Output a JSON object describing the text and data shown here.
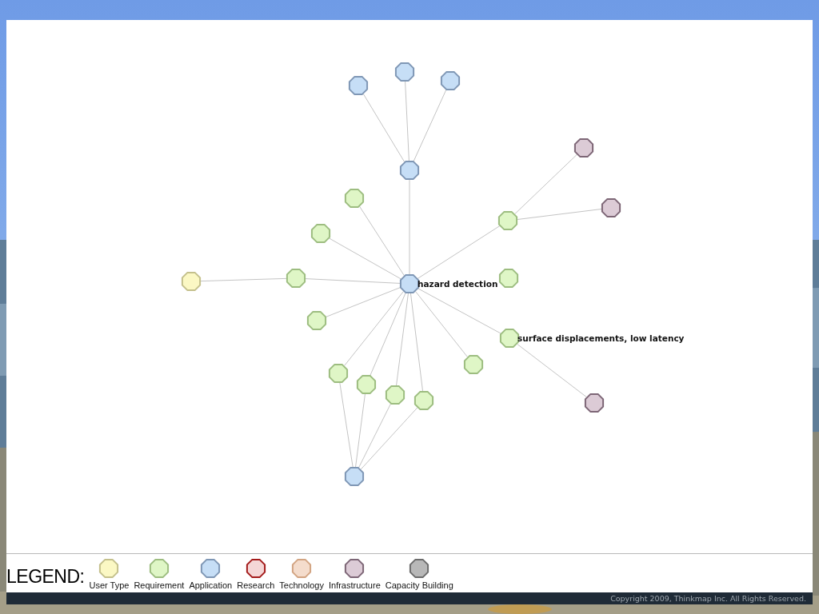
{
  "graph": {
    "nodes": [
      {
        "kind": "application",
        "label": "hazard detection"
      },
      {
        "kind": "application"
      },
      {
        "kind": "application"
      },
      {
        "kind": "application"
      },
      {
        "kind": "application"
      },
      {
        "kind": "requirement"
      },
      {
        "kind": "requirement"
      },
      {
        "kind": "requirement"
      },
      {
        "kind": "user_type"
      },
      {
        "kind": "requirement"
      },
      {
        "kind": "requirement"
      },
      {
        "kind": "infrastructure"
      },
      {
        "kind": "infrastructure"
      },
      {
        "kind": "requirement"
      },
      {
        "kind": "requirement",
        "label": "surface displacements, low latency"
      },
      {
        "kind": "infrastructure"
      },
      {
        "kind": "requirement"
      },
      {
        "kind": "requirement"
      },
      {
        "kind": "requirement"
      },
      {
        "kind": "requirement"
      },
      {
        "kind": "requirement"
      },
      {
        "kind": "application"
      }
    ]
  },
  "legend": {
    "title": "LEGEND:",
    "items": [
      {
        "kind": "user_type",
        "label": "User Type",
        "color": "#fbf8c4"
      },
      {
        "kind": "requirement",
        "label": "Requirement",
        "color": "#dff6c6"
      },
      {
        "kind": "application",
        "label": "Application",
        "color": "#c6def6"
      },
      {
        "kind": "research",
        "label": "Research",
        "color": "#f4d6d6"
      },
      {
        "kind": "technology",
        "label": "Technology",
        "color": "#f4dccc"
      },
      {
        "kind": "infrastructure",
        "label": "Infrastructure",
        "color": "#dccbd6"
      },
      {
        "kind": "capacity_building",
        "label": "Capacity Building",
        "color": "#b8b8b8"
      }
    ]
  },
  "footer": {
    "copyright": "Copyright 2009, Thinkmap Inc. All Rights Reserved."
  }
}
